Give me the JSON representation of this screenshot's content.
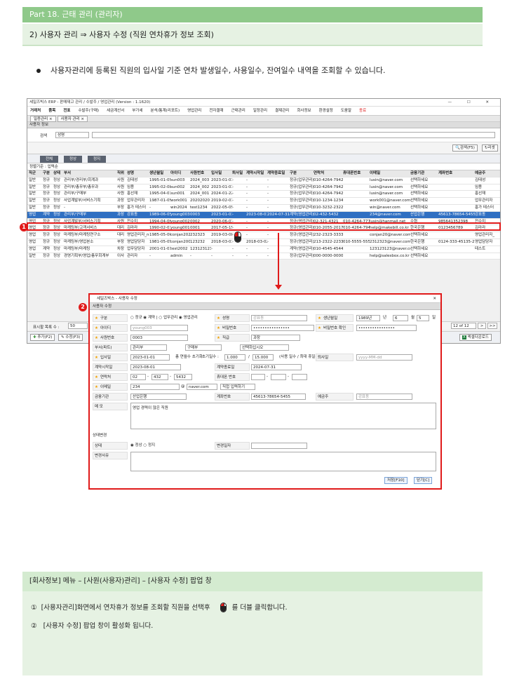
{
  "header": {
    "part": "Part 18. 근태 관리 (관리자)",
    "subtitle": "2) 사용자 관리 ⇒ 사용자 수정 (직원 연차휴가 정보 조회)"
  },
  "bullet": "사용자관리에 등록된 직원의 입사일 기준 연차 발생일수, 사용일수, 잔여일수 내역을 조회할 수 있습니다.",
  "app": {
    "title": "세일즈빅스 ERP - 판매재고 관리 / 수발주 / 영업관리 (Version : 1.1620)",
    "window_controls": "— ☐ ✕",
    "menu": [
      "거래처",
      "품목",
      "전표",
      "수발주(구매)",
      "세금계산서",
      "부가세",
      "분석/통계(리포트)",
      "영업관리",
      "전자결재",
      "근태관리",
      "일정관리",
      "결제관리",
      "회사정보",
      "환경설정",
      "도움말",
      "종료"
    ],
    "tabs": [
      "일증관리 ×",
      "사용자 관리 ×"
    ],
    "section": "사용자 정보",
    "search_label": "검색",
    "search_select": "성명",
    "btn_search": "검색(F5)",
    "btn_reset": "리셋",
    "filter_buttons": [
      "전체",
      "정상",
      "정지"
    ],
    "criteria": "정렬기준 : 입력순",
    "columns": [
      "직군",
      "구분",
      "상태",
      "부서",
      "직위",
      "성명",
      "생년월일",
      "아이디",
      "사원번호",
      "입사일",
      "퇴사일",
      "계약시작일",
      "계약종료일",
      "구분",
      "연락처",
      "휴대폰번호",
      "이메일",
      "금융기관",
      "계좌번호",
      "예금주"
    ],
    "rows": [
      [
        "일반",
        "정규",
        "정상",
        "관리부/경리부/회계과",
        "사원",
        "김태성",
        "1995-01-05",
        "sun003",
        "2024_003",
        "2023-01-01",
        "-",
        "-",
        "-",
        "정규(업무관리)",
        "010-4264-7942",
        "",
        "lusin@naver.com",
        "선택하세요",
        "",
        "김태성"
      ],
      [
        "일반",
        "정규",
        "정상",
        "관리부/총무부/총무과",
        "사원",
        "임용",
        "1995-02-08",
        "sun002",
        "2024_002",
        "2023-01-01",
        "-",
        "-",
        "-",
        "정규(업무관리)",
        "010-4264-7942",
        "",
        "lusin@naver.com",
        "선택하세요",
        "",
        "임용"
      ],
      [
        "일반",
        "정규",
        "정상",
        "관리부/구매부",
        "사원",
        "홍선재",
        "1995-04-01",
        "sun001",
        "2024_001",
        "2024-01-22",
        "-",
        "-",
        "-",
        "정규(업무관리)",
        "010-4264-7942",
        "",
        "lusin@naver.com",
        "선택하세요",
        "",
        "홍선재"
      ],
      [
        "일반",
        "정규",
        "정상",
        "사업계발부/서비스기획",
        "과장",
        "업무관리자",
        "1987-01-05",
        "work001",
        "20202020",
        "2019-02-01",
        "-",
        "-",
        "-",
        "정규(업무관리)",
        "010-1234-1234",
        "",
        "work001@naver.com",
        "선택하세요",
        "",
        "업무관리자"
      ],
      [
        "일반",
        "정규",
        "정상",
        "-",
        "부장",
        "홍가 테스터",
        "-",
        "win2024",
        "test1234",
        "2022-05-05",
        "-",
        "-",
        "-",
        "정규(업무관리)",
        "010-3232-2322",
        "",
        "win@naver.com",
        "선택하세요",
        "",
        "홍가 테스터"
      ],
      [
        "영업",
        "계약",
        "정상",
        "관리부/구매부",
        "과장",
        "강표동",
        "1989-06-05",
        "young003",
        "0003",
        "2023-01-01",
        "-",
        "2023-08-01",
        "2024-07-31",
        "계약(영업관리)",
        "02-432-5432",
        "",
        "234@naver.com",
        "산업은행",
        "45613-78654-5455",
        "강표동"
      ],
      [
        "영업",
        "정규",
        "정상",
        "사업계발부/서비스기획",
        "사원",
        "전수미",
        "1994-04-06",
        "young002",
        "0002",
        "2020-06-01",
        "-",
        "-",
        "-",
        "정규(영업관리)",
        "02-321-4321",
        "010-4264-7777",
        "lusin@hanmail.net",
        "수협",
        "985641352398",
        "전수미"
      ],
      [
        "영업",
        "정규",
        "정상",
        "마케팅부/고객서비스",
        "대리",
        "김라라",
        "1990-02-01",
        "young001",
        "0001",
        "2017-05-15",
        "-",
        "-",
        "-",
        "정규(영업관리)",
        "010-2055-2017",
        "010-4264-7942",
        "help@makebill.co.kr",
        "한국은행",
        "0123456789",
        "김라라"
      ],
      [
        "영업",
        "정규",
        "정상",
        "마케팅부/마케팅연구소",
        "대리",
        "영업관리자_new",
        "1985-05-06",
        "conjan2020",
        "232323",
        "2019-03-08",
        "-",
        "-",
        "-",
        "정규(영업관리)",
        "232-2323-3333",
        "",
        "conjan20@naver.com",
        "선택하세요",
        "",
        "영업관리자_"
      ],
      [
        "영업",
        "정규",
        "정상",
        "마케팅부/영업본소",
        "부장",
        "영업담당자",
        "1981-05-05",
        "conjan2002",
        "123232",
        "2018-03-01",
        "-",
        "2018-03-02",
        "-",
        "정규(영업관리)",
        "213-2322-2233",
        "010-5555-5555",
        "2312323@naver.com",
        "한국은행",
        "0124-333-45135-22",
        "영업담당자"
      ],
      [
        "영업",
        "계약",
        "정상",
        "마케팅부/마케팅",
        "차장",
        "업무담당자",
        "2001-01-01",
        "test2002",
        "123123123",
        "-",
        "-",
        "-",
        "-",
        "계약(영업관리)",
        "010-4545-4544",
        "",
        "123123123@naver.com",
        "선택하세요",
        "",
        "테스트"
      ],
      [
        "일반",
        "정규",
        "정상",
        "경영기획부/영업/총무회계부",
        "이사",
        "관리자",
        "-",
        "admin",
        "-",
        "-",
        "-",
        "-",
        "-",
        "정규(업무관리)",
        "000-0000-0000",
        "",
        "help@salesbox.co.kr",
        "선택하세요",
        "",
        ""
      ]
    ],
    "pagination_label": "표시할 목록 수 :",
    "pagination_value": "50",
    "page_info": "12 of 12",
    "btn_add": "추가(F2)",
    "btn_edit": "수정(F3)",
    "btn_excel": "엑셀다운로드"
  },
  "popup": {
    "title": "세일즈박스 - 사용자 수정",
    "close": "✕",
    "section": "사용자 수정",
    "kind_label": "구분",
    "kind_options": "○ 정규 ◉ 계약 | ○ 업무관리 ◉ 영업관리",
    "name_label": "성명",
    "name_value": "강표동",
    "birth_label": "생년월일",
    "birth_year": "1989년",
    "birth_year_unit": "년",
    "birth_month": "6",
    "birth_month_unit": "월",
    "birth_day": "5",
    "birth_day_unit": "일",
    "id_label": "아이디",
    "id_value": "young003",
    "pw_label": "비밀번호",
    "pw_value": "••••••••••••••••",
    "pw2_label": "비밀번호 확인",
    "pw2_value": "••••••••••••••••",
    "empno_label": "사원번호",
    "empno_value": "0003",
    "rank_label": "직급",
    "rank_value": "과장",
    "dept_label": "부서(파트)",
    "dept_value1": "관리부",
    "dept_value2": "구매부",
    "dept_value3": "선택하십시오",
    "join_label": "입사일",
    "join_value": "2023-01-01",
    "leave_total_label": "총 연월수 초기화",
    "leave_init_label": "초기일수 :",
    "leave_init": "1.000",
    "leave_slash": "/",
    "leave_total": "15.000",
    "leave_hint": "(사용 일수 / 최대 휴일수)",
    "retire_label": "퇴사일",
    "retire_value": "yyyy-MM-dd",
    "cstart_label": "계약시작일",
    "cstart_value": "2023-08-01",
    "cend_label": "계약종료일",
    "cend_value": "2024-07-31",
    "phone_label": "연락처",
    "phone1": "02",
    "phone2": "432",
    "phone3": "5432",
    "dash": "-",
    "mobile_label": "휴대폰 번호",
    "email_label": "이메일",
    "email_user": "234",
    "email_at": "@",
    "email_domain": "naver.com",
    "email_direct": "직접 입력하기",
    "bank_label": "금융기관",
    "bank_value": "산업은행",
    "account_label": "계좌번호",
    "account_value": "45613-78654-5455",
    "holder_label": "예금주",
    "holder_value": "강표동",
    "memo_label": "메 모",
    "memo_value": "영업 경력이 많은 직원",
    "status_section": "상태변경",
    "status_label": "상태",
    "status_options": "◉ 정상 ○ 정지",
    "change_date_label": "변경일자",
    "change_reason_label": "변경사유",
    "btn_save": "저장[F10]",
    "btn_close": "닫기[C]"
  },
  "markers": {
    "one": "1",
    "two": "2"
  },
  "notes": {
    "title": "[회사정보] 메뉴 – [사원(사용자)관리] – [사용자 수정] 팝업 창",
    "step1_num": "①",
    "step1_a": "[사용자관리]화면에서 연차휴가 정보를 조회할 직원을 선택후",
    "step1_b": "를 더블 클릭합니다.",
    "step2_num": "②",
    "step2": "[사용자 수정] 팝업 창이 활성화 됩니다."
  },
  "colors": {
    "accent_green": "#8fc98a",
    "highlight_red": "#e01a1a",
    "selected_row": "#2f6fc2"
  }
}
